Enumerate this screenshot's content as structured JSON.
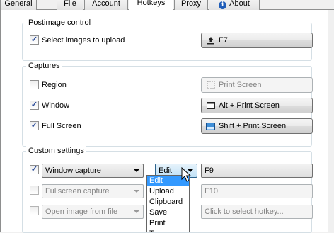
{
  "tabs": [
    {
      "label": "General"
    },
    {
      "label": "File"
    },
    {
      "label": "Account"
    },
    {
      "label": "Hotkeys",
      "active": true
    },
    {
      "label": "Proxy"
    },
    {
      "label": "About",
      "icon": "info-icon"
    }
  ],
  "postimage": {
    "title": "Postimage control",
    "select_label": "Select images to upload",
    "select_checked": true,
    "select_hotkey": "F7",
    "select_hotkey_icon": "upload-arrow-icon"
  },
  "captures": {
    "title": "Captures",
    "rows": [
      {
        "label": "Region",
        "checked": false,
        "hotkey": "Print Screen",
        "icon": "region-icon",
        "enabled": false
      },
      {
        "label": "Window",
        "checked": true,
        "hotkey": "Alt + Print Screen",
        "icon": "window-icon",
        "enabled": true
      },
      {
        "label": "Full Screen",
        "checked": true,
        "hotkey": "Shift + Print Screen",
        "icon": "fullscreen-icon",
        "enabled": true
      }
    ]
  },
  "custom": {
    "title": "Custom settings",
    "rows": [
      {
        "checked": true,
        "source": "Window capture",
        "action": "Edit",
        "hotkey": "F9",
        "enabled": true
      },
      {
        "checked": false,
        "source": "Fullscreen capture",
        "action": "",
        "hotkey": "F10",
        "enabled": false
      },
      {
        "checked": false,
        "source": "Open image from file",
        "action": "",
        "hotkey": "Click to select hotkey...",
        "enabled": false
      }
    ],
    "dropdown_options": [
      "Edit",
      "Upload",
      "Clipboard",
      "Save",
      "Print",
      "Tw"
    ],
    "dropdown_selected": "Edit"
  },
  "colors": {
    "accent": "#3399ff",
    "checkmark": "#2b4c9a"
  }
}
